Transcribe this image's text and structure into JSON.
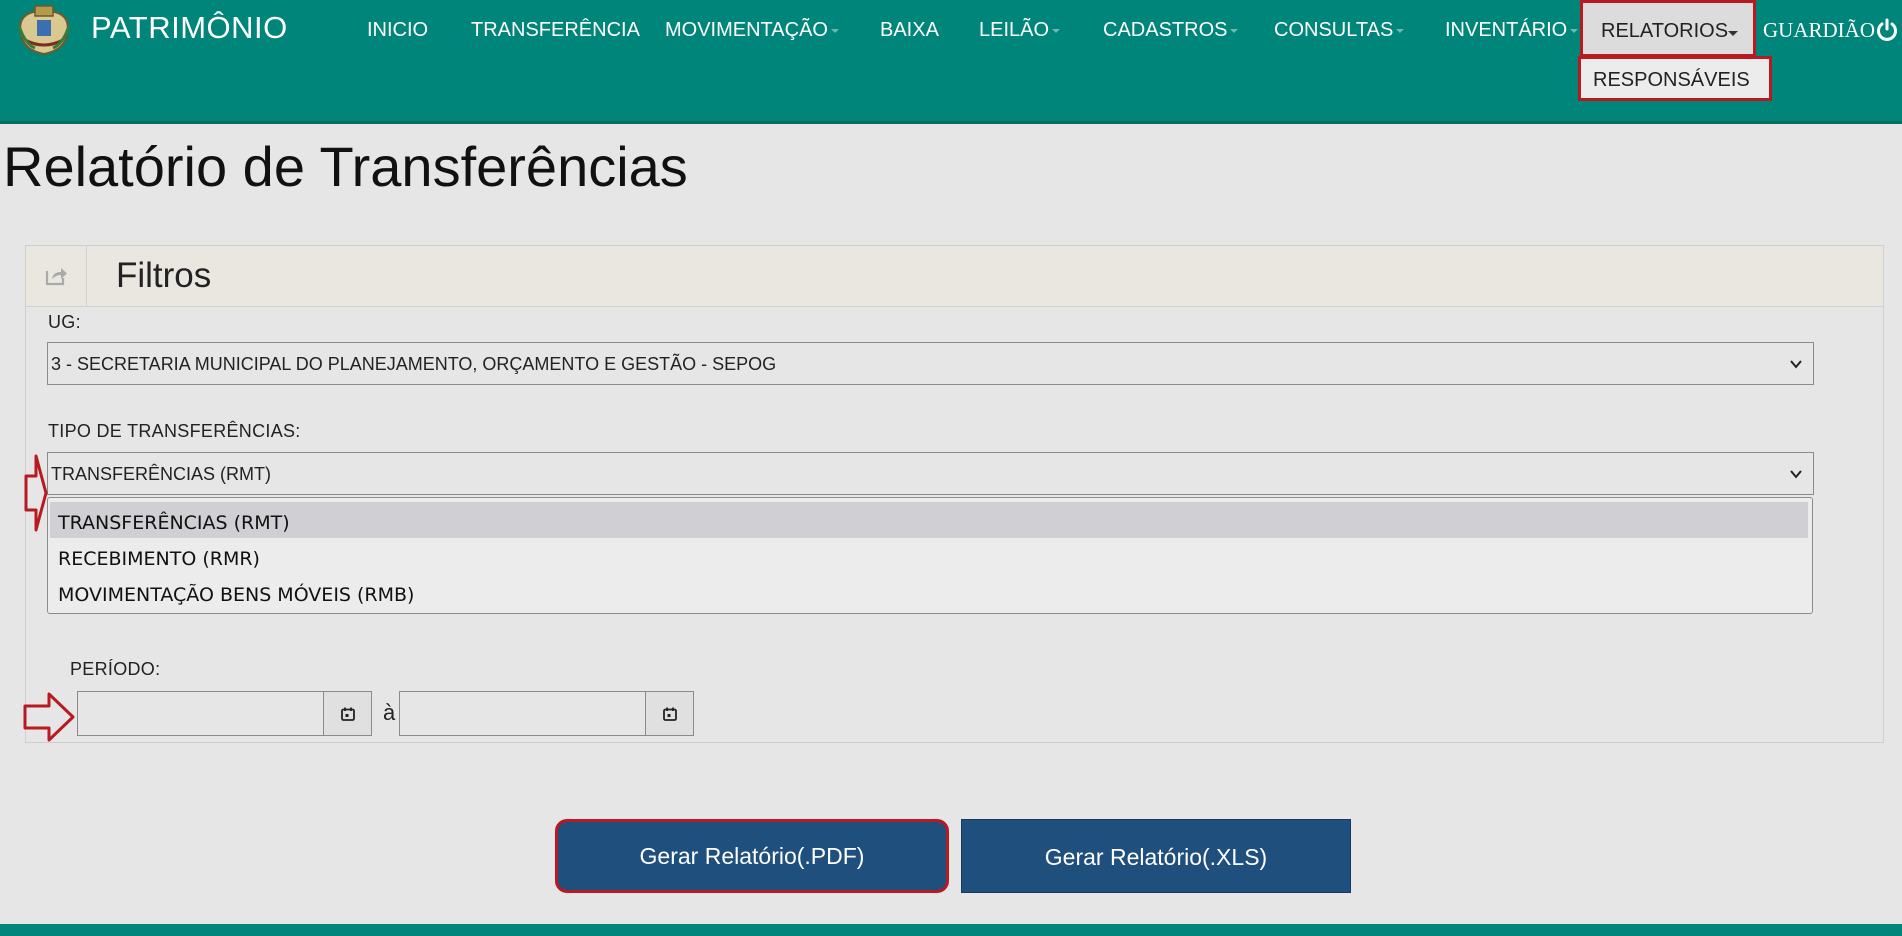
{
  "app": {
    "title": "PATRIMÔNIO"
  },
  "nav": {
    "items": [
      {
        "label": "INICIO",
        "dropdown": false
      },
      {
        "label": "TRANSFERÊNCIA",
        "dropdown": false
      },
      {
        "label": "MOVIMENTAÇÃO",
        "dropdown": true
      },
      {
        "label": "BAIXA",
        "dropdown": false
      },
      {
        "label": "LEILÃO",
        "dropdown": true
      },
      {
        "label": "CADASTROS",
        "dropdown": true
      },
      {
        "label": "CONSULTAS",
        "dropdown": true
      },
      {
        "label": "INVENTÁRIO",
        "dropdown": true
      }
    ],
    "reports": {
      "label": "RELATORIOS",
      "menu_item": "RESPONSÁVEIS"
    },
    "user": "GUARDIÃO"
  },
  "page": {
    "title": "Relatório de Transferências"
  },
  "filters": {
    "title": "Filtros",
    "ug": {
      "label": "UG:",
      "value": "3 - SECRETARIA MUNICIPAL DO PLANEJAMENTO, ORÇAMENTO E GESTÃO - SEPOG"
    },
    "tipo": {
      "label": "TIPO DE TRANSFERÊNCIAS:",
      "value": "TRANSFERÊNCIAS (RMT)",
      "options": [
        "TRANSFERÊNCIAS (RMT)",
        "RECEBIMENTO (RMR)",
        "MOVIMENTAÇÃO BENS MÓVEIS (RMB)"
      ]
    },
    "periodo": {
      "label": "PERÍODO:",
      "separator": "à",
      "start": "",
      "end": ""
    }
  },
  "actions": {
    "pdf": "Gerar Relatório(.PDF)",
    "xls": "Gerar Relatório(.XLS)"
  },
  "colors": {
    "navbar": "#00857a",
    "highlight": "#b81a22",
    "button": "#1f4f7d"
  }
}
